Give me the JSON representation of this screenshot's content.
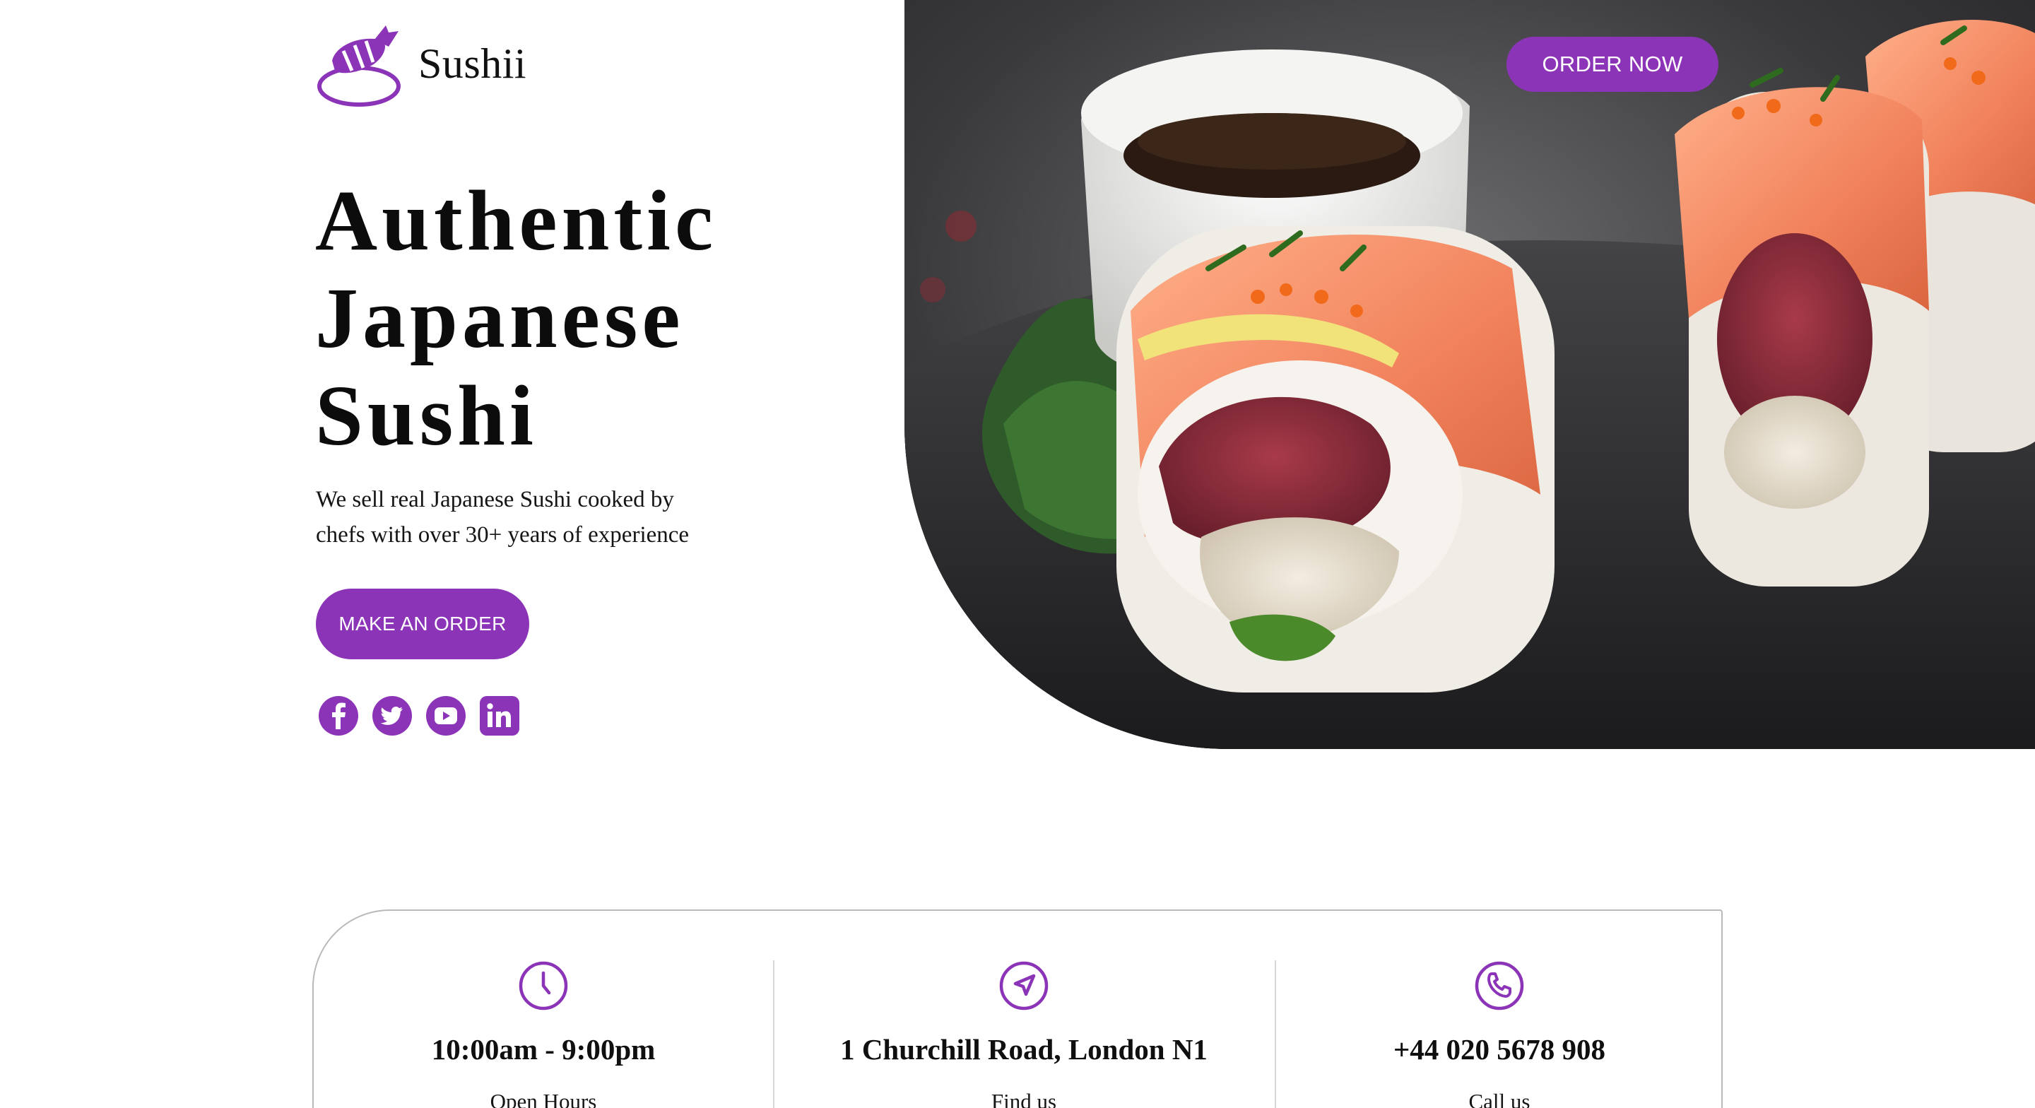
{
  "brand": {
    "name": "Sushii",
    "accent_color": "#8c34b8",
    "logo_icon": "sushi-logo-icon"
  },
  "header": {
    "order_now_label": "ORDER NOW"
  },
  "hero": {
    "title_lines": [
      "Authentic",
      "Japanese",
      "Sushi"
    ],
    "subtitle_line1": "We sell real Japanese Sushi cooked by",
    "subtitle_line2": "chefs with over 30+ years of experience",
    "cta_label": "MAKE AN ORDER",
    "image": "sushi-rolls-photo"
  },
  "social": [
    {
      "name": "facebook",
      "icon": "facebook-icon"
    },
    {
      "name": "twitter",
      "icon": "twitter-icon"
    },
    {
      "name": "youtube",
      "icon": "youtube-icon"
    },
    {
      "name": "linkedin",
      "icon": "linkedin-icon"
    }
  ],
  "info": [
    {
      "icon": "clock-icon",
      "value": "10:00am - 9:00pm",
      "label": "Open Hours"
    },
    {
      "icon": "navigation-icon",
      "value": "1 Churchill Road, London N1",
      "label": "Find us"
    },
    {
      "icon": "phone-icon",
      "value": "+44 020 5678 908",
      "label": "Call us"
    }
  ]
}
